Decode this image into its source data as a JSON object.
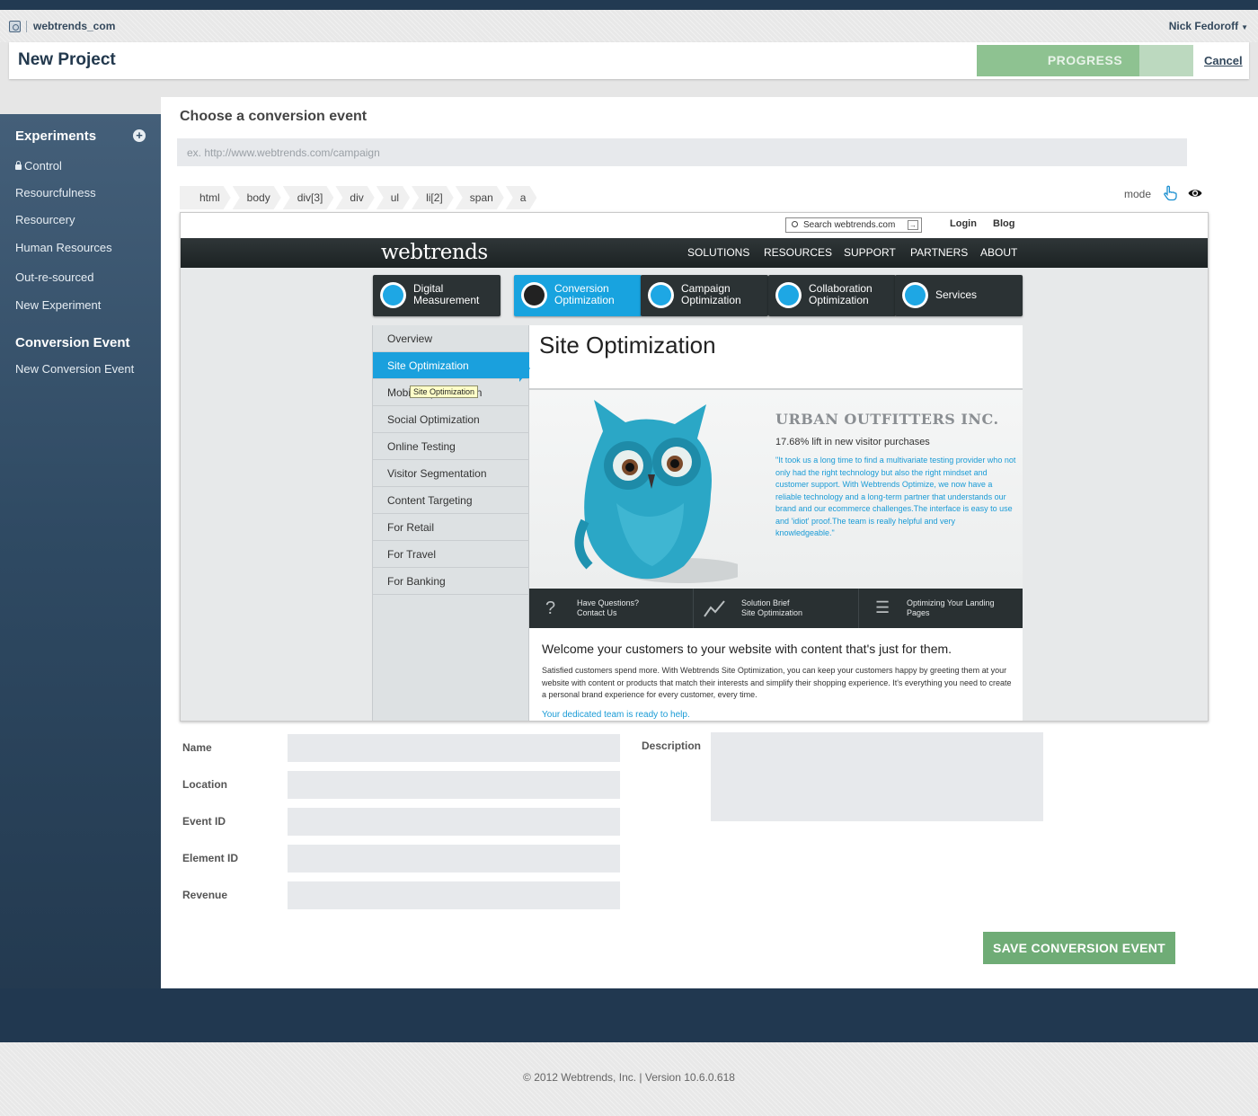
{
  "app": {
    "brand": "webtrends_com",
    "user": "Nick Fedoroff",
    "project_title": "New Project",
    "progress_label": "PROGRESS",
    "progress_value": 0.75,
    "cancel_label": "Cancel"
  },
  "sidebar": {
    "experiments_header": "Experiments",
    "experiments": [
      "Control",
      "Resourcfulness",
      "Resourcery",
      "Human Resources",
      "Out-re-sourced",
      "New Experiment"
    ],
    "conversion_header": "Conversion Event",
    "conversion_items": [
      "New Conversion Event"
    ]
  },
  "main": {
    "title": "Choose a conversion event",
    "url_placeholder": "ex. http://www.webtrends.com/campaign",
    "breadcrumbs": [
      "html",
      "body",
      "div[3]",
      "div",
      "ul",
      "li[2]",
      "span",
      "a"
    ],
    "mode_label": "mode"
  },
  "preview": {
    "search_text": "Search webtrends.com",
    "login": "Login",
    "blog": "Blog",
    "logo": "webtrends",
    "nav": [
      "SOLUTIONS",
      "RESOURCES",
      "SUPPORT",
      "PARTNERS",
      "ABOUT"
    ],
    "tiles": [
      {
        "l1": "Digital",
        "l2": "Measurement"
      },
      {
        "l1": "Conversion",
        "l2": "Optimization"
      },
      {
        "l1": "Campaign",
        "l2": "Optimization"
      },
      {
        "l1": "Collaboration",
        "l2": "Optimization"
      },
      {
        "l1": "Services",
        "l2": ""
      }
    ],
    "side_menu": [
      "Overview",
      "Site Optimization",
      "Mobile Optimization",
      "Social Optimization",
      "Online Testing",
      "Visitor Segmentation",
      "Content Targeting",
      "For Retail",
      "For Travel",
      "For Banking"
    ],
    "tooltip": "Site Optimization",
    "heading": "Site Optimization",
    "company": "URBAN OUTFITTERS INC.",
    "lift": "17.68% lift in new visitor purchases",
    "quote": "\"It took us a long time to find a multivariate testing provider who not only had the right technology but also the right mindset and customer support. With Webtrends Optimize, we now have a reliable technology and a long-term partner that understands our brand and our ecommerce challenges.The interface is easy to use and 'idiot' proof.The team is really helpful and very knowledgeable.\"",
    "strip": [
      {
        "l1": "Have Questions?",
        "l2": "Contact Us"
      },
      {
        "l1": "Solution Brief",
        "l2": "Site Optimization"
      },
      {
        "l1": "Optimizing Your Landing",
        "l2": "Pages"
      }
    ],
    "welcome": "Welcome your customers to your website with content that's just for them.",
    "body": "Satisfied customers spend more. With Webtrends Site Optimization, you can keep your customers happy by greeting them at your website with content or products that match their interests and simplify their shopping experience. It's everything you need to create a personal brand experience for every customer, every time.",
    "team": "Your dedicated team is ready to help."
  },
  "form": {
    "name_label": "Name",
    "location_label": "Location",
    "event_id_label": "Event ID",
    "element_id_label": "Element ID",
    "revenue_label": "Revenue",
    "description_label": "Description",
    "save_label": "SAVE CONVERSION EVENT"
  },
  "footer": {
    "text": "© 2012 Webtrends, Inc. | Version 10.6.0.618"
  }
}
